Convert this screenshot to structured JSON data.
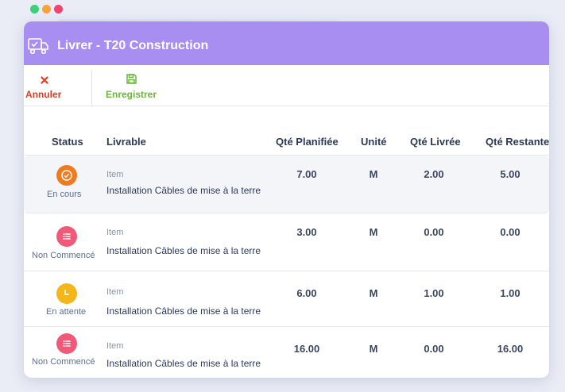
{
  "window": {
    "title": "Livrer - T20 Construction",
    "icon": "delivery-truck-icon",
    "dot_colors": [
      "#3ccf7a",
      "#f7a23c",
      "#f0436e"
    ]
  },
  "toolbar": {
    "cancel_label": "Annuler",
    "cancel_icon": "close-icon",
    "save_label": "Enregistrer",
    "save_icon": "floppy-disk-icon"
  },
  "table": {
    "headers": {
      "status": "Status",
      "livrable": "Livrable",
      "planned": "Qté Planifiée",
      "unit": "Unité",
      "delivered": "Qté Livrée",
      "remaining": "Qté Restante"
    },
    "rows": [
      {
        "status": "En cours",
        "status_icon": "clock-check-icon",
        "status_color": "#f07a1e",
        "type": "Item",
        "description": "Installation Câbles de mise à la terre",
        "planned": "7.00",
        "unit": "M",
        "delivered": "2.00",
        "remaining": "5.00"
      },
      {
        "status": "Non Commencé",
        "status_icon": "list-icon",
        "status_color": "#f05a78",
        "type": "Item",
        "description": "Installation Câbles de mise à la terre",
        "planned": "3.00",
        "unit": "M",
        "delivered": "0.00",
        "remaining": "0.00"
      },
      {
        "status": "En attente",
        "status_icon": "clock-icon",
        "status_color": "#f5b619",
        "type": "Item",
        "description": "Installation Câbles de mise à la terre",
        "planned": "6.00",
        "unit": "M",
        "delivered": "1.00",
        "remaining": "1.00"
      },
      {
        "status": "Non Commencé",
        "status_icon": "list-icon",
        "status_color": "#f05a78",
        "type": "Item",
        "description": "Installation Câbles de mise à la terre",
        "planned": "16.00",
        "unit": "M",
        "delivered": "0.00",
        "remaining": "16.00"
      }
    ]
  }
}
